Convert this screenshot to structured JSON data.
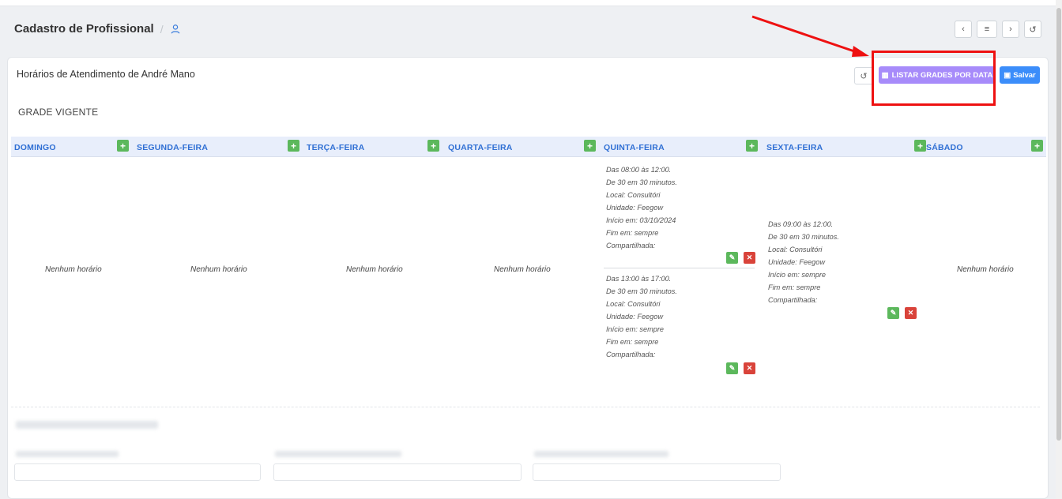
{
  "header": {
    "title": "Cadastro de Profissional",
    "separator": "/"
  },
  "card": {
    "title": "Horários de Atendimento de André Mano",
    "list_button": "LISTAR GRADES POR DATA",
    "save_button": "Salvar",
    "section_title": "GRADE VIGENTE"
  },
  "days": [
    "DOMINGO",
    "SEGUNDA-FEIRA",
    "TERÇA-FEIRA",
    "QUARTA-FEIRA",
    "QUINTA-FEIRA",
    "SEXTA-FEIRA",
    "SÁBADO"
  ],
  "empty_label": "Nenhum horário",
  "schedules": {
    "thursday": [
      {
        "hours": "Das 08:00 às 12:00.",
        "interval": "De 30 em 30 minutos.",
        "local": "Local: Consultóri",
        "unit": "Unidade: Feegow",
        "start": "Início em: 03/10/2024",
        "end": "Fim em: sempre",
        "shared": "Compartilhada:"
      },
      {
        "hours": "Das 13:00 às 17:00.",
        "interval": "De 30 em 30 minutos.",
        "local": "Local: Consultóri",
        "unit": "Unidade: Feegow",
        "start": "Início em: sempre",
        "end": "Fim em: sempre",
        "shared": "Compartilhada:"
      }
    ],
    "friday": [
      {
        "hours": "Das 09:00 às 12:00.",
        "interval": "De 30 em 30 minutos.",
        "local": "Local: Consultóri",
        "unit": "Unidade: Feegow",
        "start": "Início em: sempre",
        "end": "Fim em: sempre",
        "shared": "Compartilhada:"
      }
    ]
  },
  "colors": {
    "accent_blue": "#2f6fd4",
    "list_button": "#a78bfa",
    "save_button": "#3b8dfa",
    "add_green": "#5cb85c",
    "delete_red": "#d9433a",
    "annotation_red": "#ee1111"
  },
  "icons": [
    "user-icon",
    "chevron-left-icon",
    "list-icon",
    "chevron-right-icon",
    "history-icon",
    "calendar-icon",
    "floppy-icon",
    "plus-icon",
    "edit-icon",
    "close-icon"
  ]
}
